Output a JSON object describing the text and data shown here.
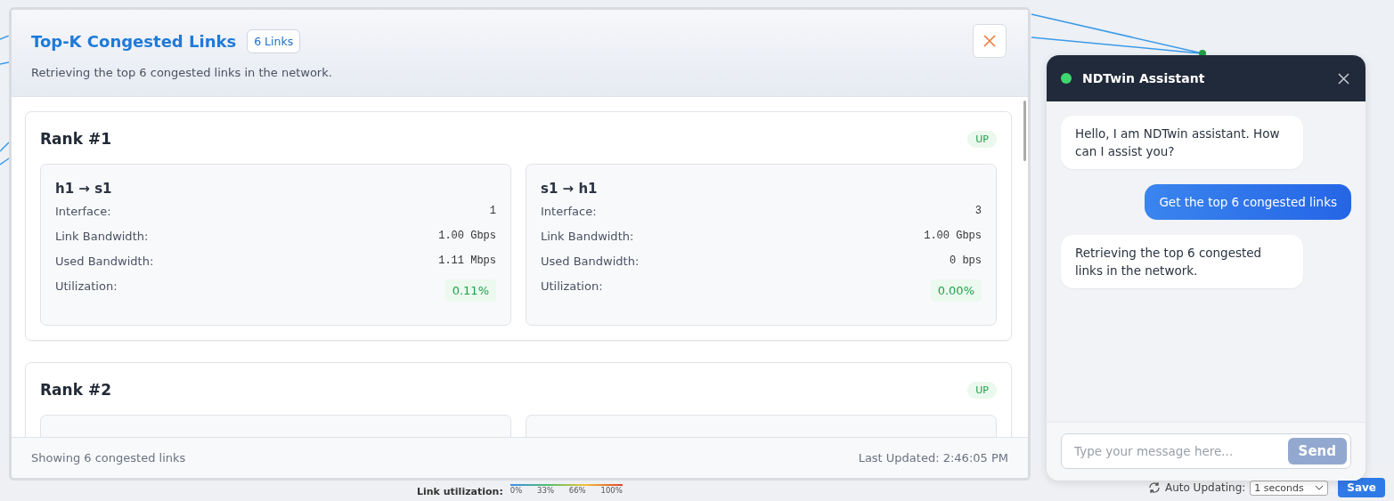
{
  "modal": {
    "title": "Top-K Congested Links",
    "count_badge": "6 Links",
    "subtitle": "Retrieving the top 6 congested links in the network.",
    "ranks": [
      {
        "title": "Rank #1",
        "status": "UP",
        "links": [
          {
            "kind": "full",
            "name": "h1 → s1",
            "fields": [
              {
                "label": "Interface:",
                "value": "1"
              },
              {
                "label": "Link Bandwidth:",
                "value": "1.00 Gbps"
              },
              {
                "label": "Used Bandwidth:",
                "value": "1.11 Mbps"
              }
            ],
            "utilization_label": "Utilization:",
            "utilization": "0.11%"
          },
          {
            "kind": "full",
            "name": "s1 → h1",
            "fields": [
              {
                "label": "Interface:",
                "value": "3"
              },
              {
                "label": "Link Bandwidth:",
                "value": "1.00 Gbps"
              },
              {
                "label": "Used Bandwidth:",
                "value": "0 bps"
              }
            ],
            "utilization_label": "Utilization:",
            "utilization": "0.00%"
          }
        ]
      },
      {
        "title": "Rank #2",
        "status": "UP",
        "links": [
          {
            "kind": "cut"
          },
          {
            "kind": "cut"
          }
        ]
      }
    ],
    "footer_left": "Showing 6 congested links",
    "footer_right": "Last Updated: 2:46:05 PM"
  },
  "chat": {
    "title": "NDTwin Assistant",
    "online": true,
    "messages": [
      {
        "kind": "bot",
        "text": "Hello, I am NDTwin assistant. How can I assist you?"
      },
      {
        "kind": "user",
        "text": "Get the top 6 congested links"
      },
      {
        "kind": "bot",
        "text": "Retrieving the top 6 congested links in the network."
      }
    ],
    "input": {
      "placeholder": "Type your message here..."
    },
    "send": "Send"
  },
  "bottom_bar": {
    "legend_label": "Link utilization:",
    "legend_ticks": [
      "0%",
      "33%",
      "66%",
      "100%"
    ],
    "auto_label": "Auto Updating:",
    "interval": "1 seconds",
    "save": "Save"
  }
}
